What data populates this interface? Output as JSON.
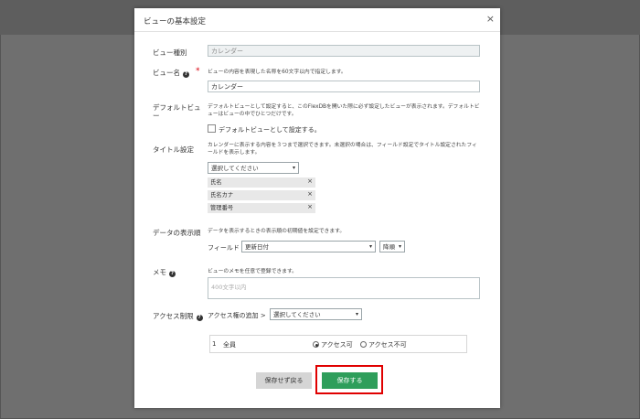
{
  "modal": {
    "title": "ビューの基本設定",
    "close": "×"
  },
  "view_type": {
    "label": "ビュー種別",
    "value": "カレンダー"
  },
  "view_name": {
    "label": "ビュー名",
    "required_mark": "*",
    "hint": "ビューの内容を表現した名称を60文字以内で指定します。",
    "value": "カレンダー"
  },
  "default_view": {
    "label_line1": "デフォルトビュ",
    "label_line2": "ー",
    "desc": "デフォルトビューとして設定すると、このFlexDBを開いた際に必ず設定したビューが表示されます。デフォルトビューはビューの中でひとつだけです。",
    "checkbox_label": "デフォルトビューとして設定する。"
  },
  "title_setting": {
    "label": "タイトル設定",
    "desc": "カレンダーに表示する内容を３つまで選択できます。未選択の場合は、フィールド設定でタイトル設定されたフィールドを表示します。",
    "select_placeholder": "選択してください",
    "tags": [
      "氏名",
      "氏名カナ",
      "管理番号"
    ],
    "tag_remove": "×"
  },
  "display_order": {
    "label": "データの表示順",
    "desc": "データを表示するときの表示順の初期値を設定できます。",
    "field_label": "フィールド",
    "field_value": "更新日付",
    "order_value": "降順"
  },
  "memo": {
    "label": "メモ",
    "desc": "ビューのメモを任意で登録できます。",
    "placeholder": "400文字以内"
  },
  "access": {
    "label": "アクセス制限",
    "add_label": "アクセス権の追加 >",
    "select_placeholder": "選択してください",
    "rows": [
      {
        "num": "1",
        "name": "全員",
        "allow": "アクセス可",
        "deny": "アクセス不可",
        "selected": "allow"
      }
    ]
  },
  "buttons": {
    "cancel": "保存せず戻る",
    "save": "保存する"
  },
  "colors": {
    "save": "#2e9e5b",
    "highlight": "#e00000",
    "required": "#d9000d"
  }
}
